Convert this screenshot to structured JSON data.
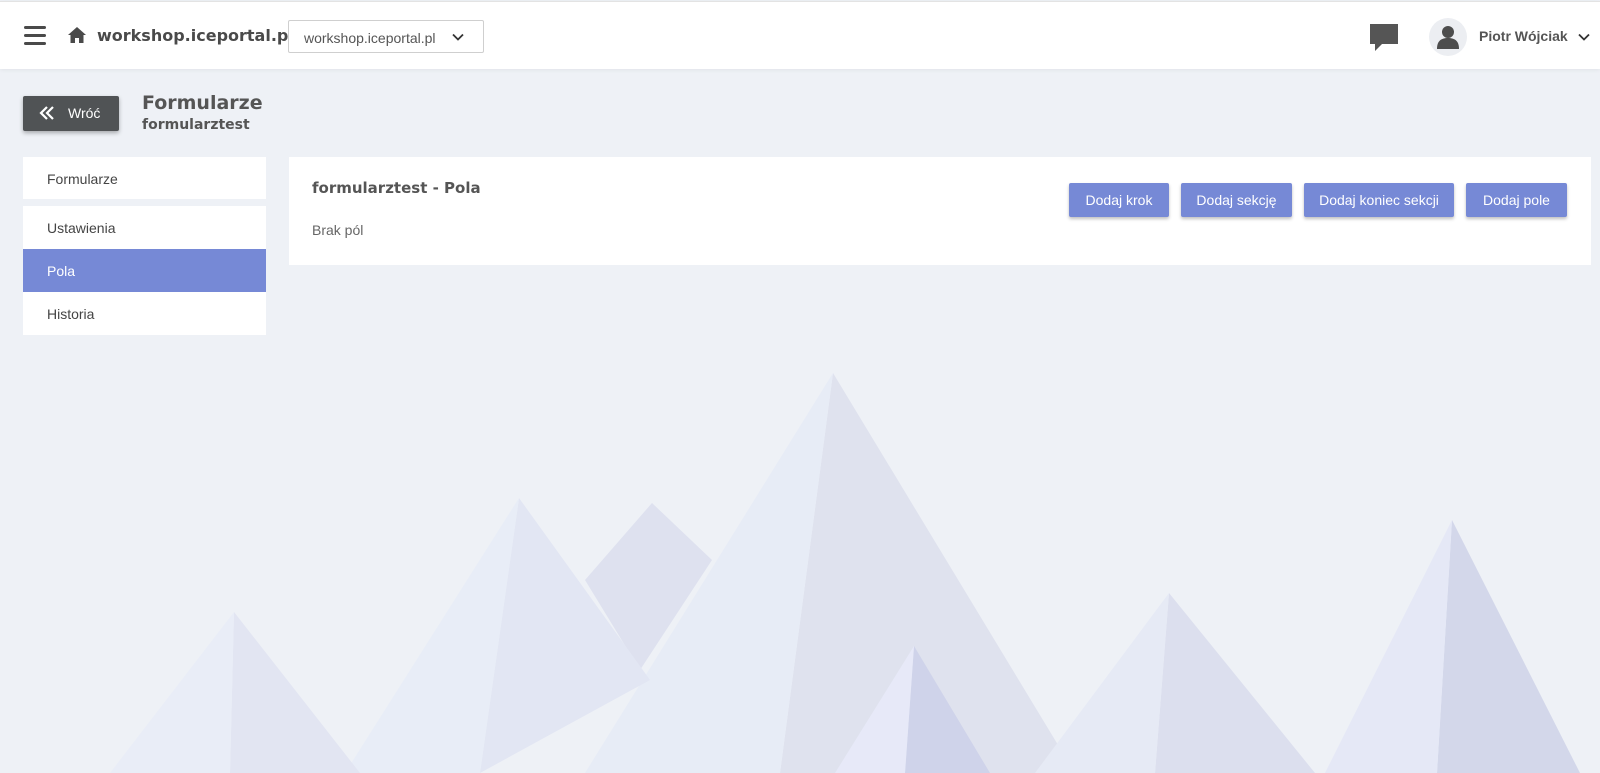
{
  "topbar": {
    "site_title": "workshop.iceportal.pl",
    "site_select_value": "workshop.iceportal.pl",
    "user_name": "Piotr Wójciak",
    "icons": [
      "hamburger-icon",
      "home-icon",
      "chevron-down-icon",
      "chat-icon",
      "user-icon"
    ]
  },
  "header": {
    "back_label": "Wróć",
    "title": "Formularze",
    "subtitle": "formularztest"
  },
  "sidebar": {
    "top_item": "Formularze",
    "items": [
      {
        "label": "Ustawienia",
        "active": false
      },
      {
        "label": "Pola",
        "active": true
      },
      {
        "label": "Historia",
        "active": false
      }
    ]
  },
  "card": {
    "title": "formularztest - Pola",
    "empty_text": "Brak pól",
    "buttons": {
      "add_step": "Dodaj krok",
      "add_section": "Dodaj sekcję",
      "add_section_end": "Dodaj koniec sekcji",
      "add_field": "Dodaj pole"
    }
  },
  "colors": {
    "accent": "#7689d6",
    "back_button": "#505355",
    "background": "#eef1f6"
  }
}
